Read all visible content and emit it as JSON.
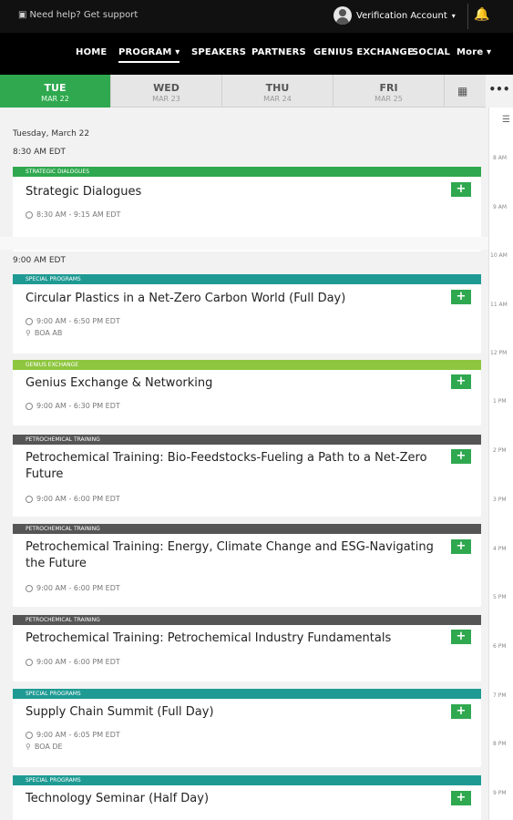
{
  "topbar": {
    "help": "Need help? Get support",
    "account": "Verification Account"
  },
  "nav": [
    "HOME",
    "PROGRAM",
    "SPEAKERS",
    "PARTNERS",
    "GENIUS EXCHANGE",
    "SOCIAL",
    "More"
  ],
  "days": [
    {
      "name": "TUE",
      "date": "MAR 22"
    },
    {
      "name": "WED",
      "date": "MAR 23"
    },
    {
      "name": "THU",
      "date": "MAR 24"
    },
    {
      "name": "FRI",
      "date": "MAR 25"
    }
  ],
  "section_date": "Tuesday, March 22",
  "slots": [
    "8:30 AM EDT",
    "9:00 AM EDT"
  ],
  "events": [
    {
      "cat": "STRATEGIC DIALOGUES",
      "title": "Strategic Dialogues",
      "time": "8:30 AM - 9:15 AM EDT",
      "loc": ""
    },
    {
      "cat": "SPECIAL PROGRAMS",
      "title": "Circular Plastics in a Net-Zero Carbon World (Full Day)",
      "time": "9:00 AM - 6:50 PM EDT",
      "loc": "BOA AB"
    },
    {
      "cat": "GENIUS EXCHANGE",
      "title": "Genius Exchange & Networking",
      "time": "9:00 AM - 6:30 PM EDT",
      "loc": ""
    },
    {
      "cat": "PETROCHEMICAL TRAINING",
      "title": "Petrochemical Training: Bio-Feedstocks-Fueling a Path to a Net-Zero Future",
      "time": "9:00 AM - 6:00 PM EDT",
      "loc": ""
    },
    {
      "cat": "PETROCHEMICAL TRAINING",
      "title": "Petrochemical Training: Energy, Climate Change and ESG-Navigating the Future",
      "time": "9:00 AM - 6:00 PM EDT",
      "loc": ""
    },
    {
      "cat": "PETROCHEMICAL TRAINING",
      "title": "Petrochemical Training: Petrochemical Industry Fundamentals",
      "time": "9:00 AM - 6:00 PM EDT",
      "loc": ""
    },
    {
      "cat": "SPECIAL PROGRAMS",
      "title": "Supply Chain Summit (Full Day)",
      "time": "9:00 AM - 6:05 PM EDT",
      "loc": "BOA DE"
    },
    {
      "cat": "SPECIAL PROGRAMS",
      "title": "Technology Seminar (Half Day)",
      "time": "",
      "loc": ""
    }
  ],
  "add_label": "+",
  "timeline": [
    "8 AM",
    "9 AM",
    "10 AM",
    "11 AM",
    "12 PM",
    "1 PM",
    "2 PM",
    "3 PM",
    "4 PM",
    "5 PM",
    "6 PM",
    "7 PM",
    "8 PM",
    "9 PM"
  ],
  "colors": {
    "accent_green": "#2fa84f",
    "strategic": "#2fa84f",
    "special": "#1e9a93",
    "genius": "#8ec63f",
    "petro": "#555555"
  }
}
